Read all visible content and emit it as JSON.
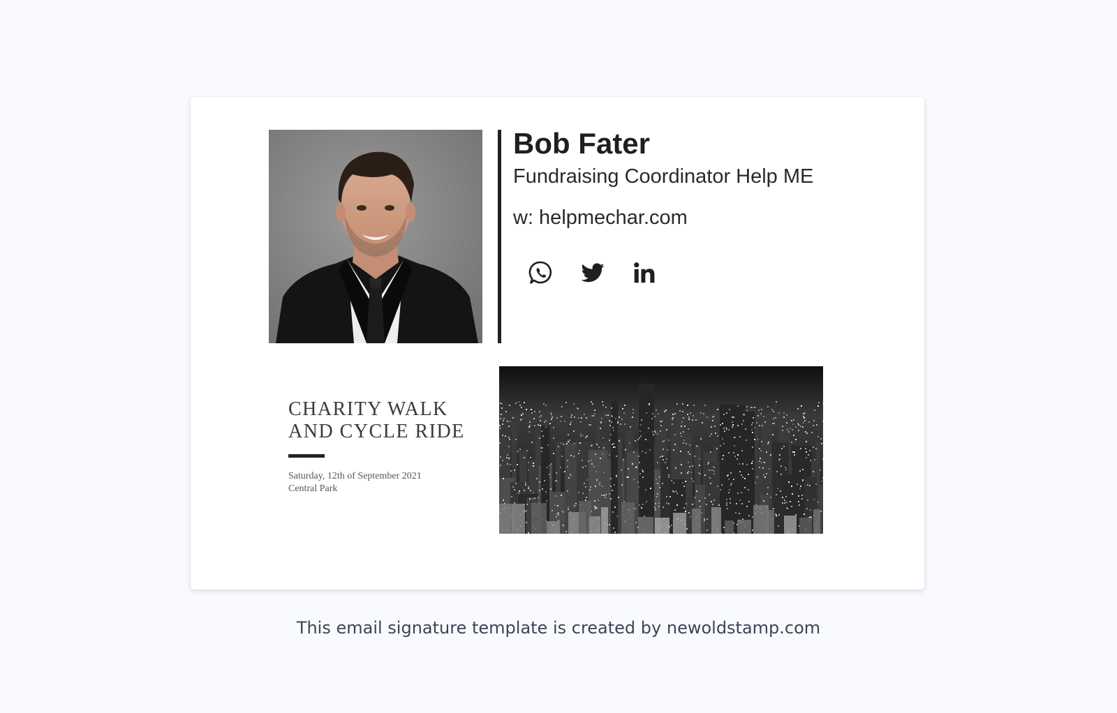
{
  "signature": {
    "name": "Bob Fater",
    "title": "Fundraising Coordinator Help ME",
    "website_label": "w: helpmechar.com",
    "social": [
      {
        "icon": "whatsapp-icon"
      },
      {
        "icon": "twitter-icon"
      },
      {
        "icon": "linkedin-icon"
      }
    ],
    "accent_color": "#222222"
  },
  "banner": {
    "title_line1": "CHARITY WALK",
    "title_line2": "AND CYCLE RIDE",
    "date": "Saturday, 12th of September 2021",
    "location": "Central Park"
  },
  "footer": {
    "caption": "This email signature template is created by newoldstamp.com"
  }
}
